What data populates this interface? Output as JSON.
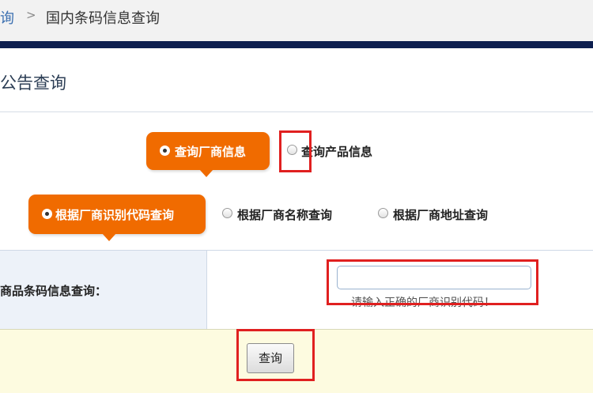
{
  "breadcrumb": {
    "parent_label": "询",
    "separator": ">",
    "current_label": "国内条码信息查询"
  },
  "page": {
    "title": "公告查询"
  },
  "query_type": {
    "options": [
      {
        "label": "查询厂商信息",
        "selected": true
      },
      {
        "label": "查询产品信息",
        "selected": false
      }
    ]
  },
  "search_by": {
    "options": [
      {
        "label": "根据厂商识别代码查询",
        "selected": true
      },
      {
        "label": "根据厂商名称查询",
        "selected": false
      },
      {
        "label": "根据厂商地址查询",
        "selected": false
      }
    ]
  },
  "form": {
    "field_label": "商品条码信息查询：",
    "input_value": "",
    "hint": "请输入正确的厂商识别代码！"
  },
  "actions": {
    "query_label": "查询"
  },
  "colors": {
    "accent_orange": "#f06b00",
    "navy_band": "#0d1e4f",
    "highlight_red": "#e02020"
  }
}
